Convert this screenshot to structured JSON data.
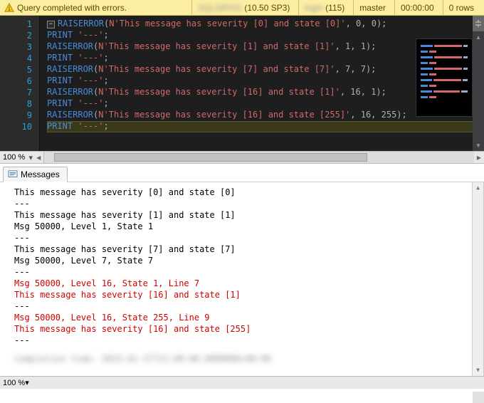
{
  "status": {
    "message": "Query completed with errors.",
    "server_blur": "SQLSRV01",
    "server_ver": "(10.50 SP3)",
    "user_blur": "login",
    "spid": "(115)",
    "db": "master",
    "elapsed": "00:00:00",
    "rows": "0 rows"
  },
  "gutter": {
    "start": 1,
    "end": 10
  },
  "code": [
    {
      "kw": "RAISERROR",
      "open": "(",
      "strPrefix": "N",
      "str": "'This message has severity [0] and state [0]'",
      "rest": ", 0, 0);"
    },
    {
      "kw": "PRINT",
      "str": " '---'",
      "rest": ";"
    },
    {
      "kw": "RAISERROR",
      "open": "(",
      "strPrefix": "N",
      "str": "'This message has severity [1] and state [1]'",
      "rest": ", 1, 1);"
    },
    {
      "kw": "PRINT",
      "str": " '---'",
      "rest": ";"
    },
    {
      "kw": "RAISERROR",
      "open": "(",
      "strPrefix": "N",
      "str": "'This message has severity [7] and state [7]'",
      "rest": ", 7, 7);"
    },
    {
      "kw": "PRINT",
      "str": " '---'",
      "rest": ";"
    },
    {
      "kw": "RAISERROR",
      "open": "(",
      "strPrefix": "N",
      "str": "'This message has severity [16] and state [1]'",
      "rest": ", 16, 1);"
    },
    {
      "kw": "PRINT",
      "str": " '---'",
      "rest": ";"
    },
    {
      "kw": "RAISERROR",
      "open": "(",
      "strPrefix": "N",
      "str": "'This message has severity [16] and state [255]'",
      "rest": ", 16, 255);"
    },
    {
      "kw": "PRINT",
      "str": " '---'",
      "rest": ";",
      "current": true
    }
  ],
  "zoom": "100 %",
  "tab": {
    "label": "Messages"
  },
  "messages": [
    {
      "t": "This message has severity [0] and state [0]",
      "c": "m"
    },
    {
      "t": "---",
      "c": "sep"
    },
    {
      "t": "This message has severity [1] and state [1]",
      "c": "m"
    },
    {
      "t": "Msg 50000, Level 1, State 1",
      "c": "m"
    },
    {
      "t": "---",
      "c": "sep"
    },
    {
      "t": "This message has severity [7] and state [7]",
      "c": "m"
    },
    {
      "t": "Msg 50000, Level 7, State 7",
      "c": "m"
    },
    {
      "t": "---",
      "c": "sep"
    },
    {
      "t": "Msg 50000, Level 16, State 1, Line 7",
      "c": "err"
    },
    {
      "t": "This message has severity [16] and state [1]",
      "c": "err"
    },
    {
      "t": "---",
      "c": "sep"
    },
    {
      "t": "Msg 50000, Level 16, State 255, Line 9",
      "c": "err"
    },
    {
      "t": "This message has severity [16] and state [255]",
      "c": "err"
    },
    {
      "t": "---",
      "c": "sep"
    }
  ],
  "footer_blur": "Completion time: 2023-01-27T12:00:00.0000000+00:00"
}
